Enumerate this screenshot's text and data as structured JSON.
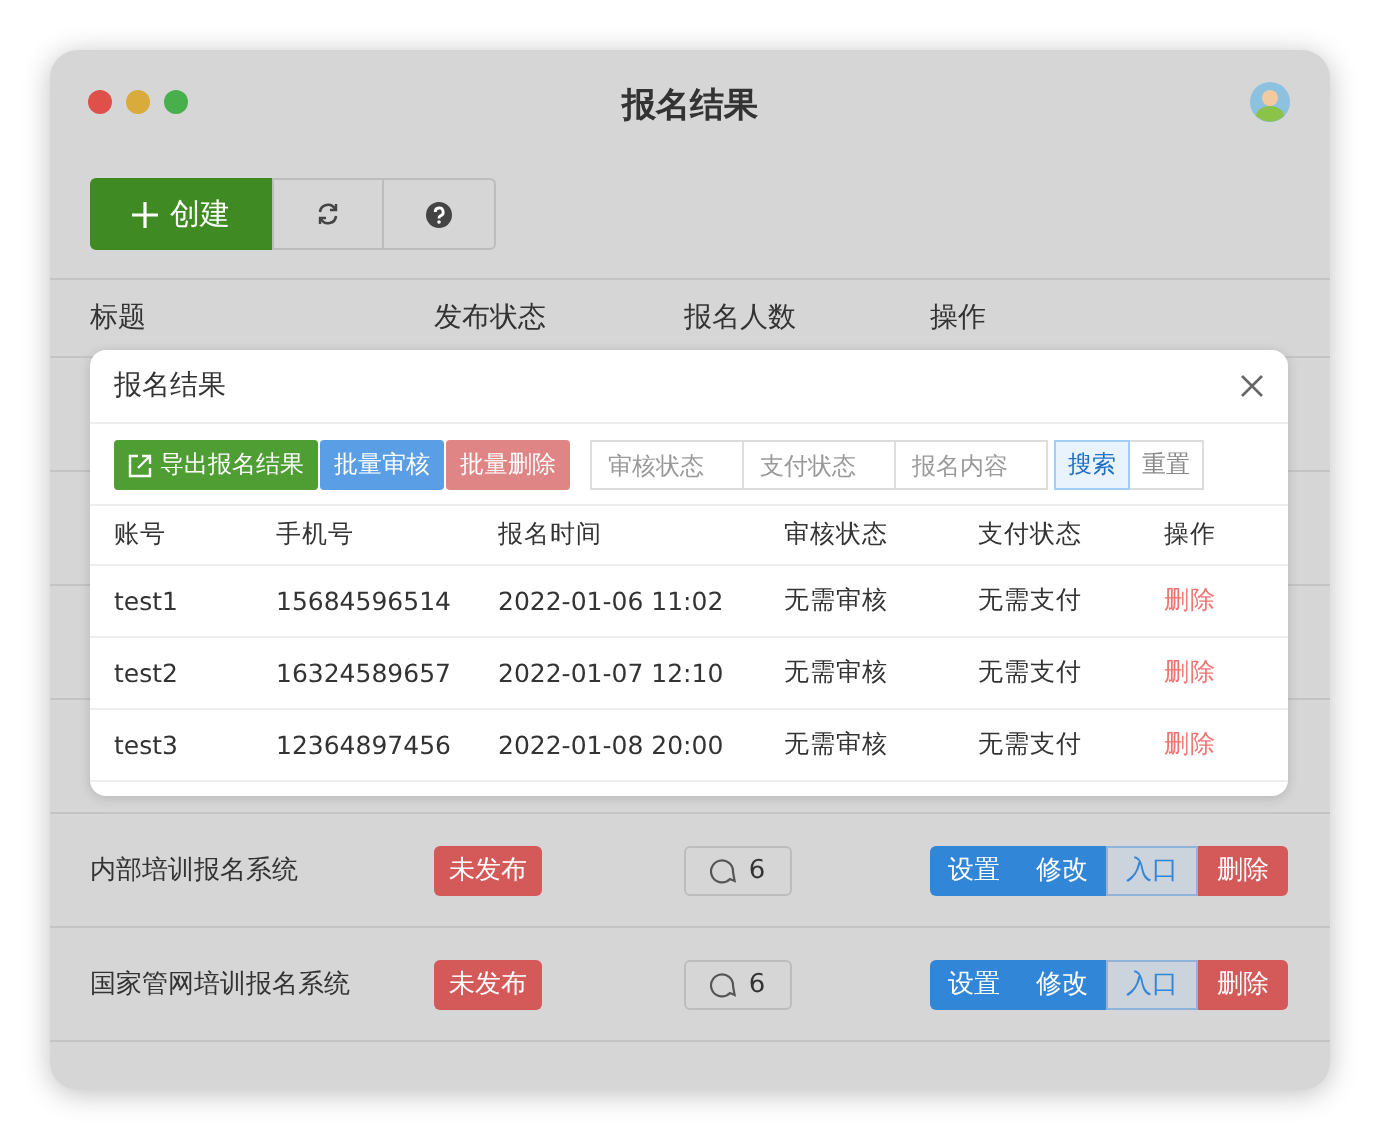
{
  "window": {
    "title": "报名结果"
  },
  "toolbar": {
    "create_button": "创建"
  },
  "table": {
    "columns": [
      "标题",
      "发布状态",
      "报名人数",
      "操作"
    ],
    "rows": [
      {
        "title": "内部培训报名系统",
        "status": "未发布",
        "count": "6",
        "actions": [
          {
            "label": "设置",
            "kind": "primary"
          },
          {
            "label": "修改",
            "kind": "primary"
          },
          {
            "label": "入口",
            "kind": "outline"
          },
          {
            "label": "删除",
            "kind": "danger"
          }
        ]
      },
      {
        "title": "国家管网培训报名系统",
        "status": "未发布",
        "count": "6",
        "actions": [
          {
            "label": "设置",
            "kind": "primary"
          },
          {
            "label": "修改",
            "kind": "primary"
          },
          {
            "label": "入口",
            "kind": "outline"
          },
          {
            "label": "删除",
            "kind": "danger"
          }
        ]
      }
    ]
  },
  "dialog": {
    "title": "报名结果",
    "buttons": [
      {
        "label": "导出报名结果",
        "kind": "export"
      },
      {
        "label": "批量审核",
        "kind": "info"
      },
      {
        "label": "批量删除",
        "kind": "danger"
      }
    ],
    "filters": [
      {
        "placeholder": "审核状态"
      },
      {
        "placeholder": "支付状态"
      },
      {
        "placeholder": "报名内容"
      }
    ],
    "search_button": "搜索",
    "reset_button": "重置",
    "columns": [
      "账号",
      "手机号",
      "报名时间",
      "审核状态",
      "支付状态",
      "操作"
    ],
    "rows": [
      {
        "account": "test1",
        "phone": "15684596514",
        "time": "2022-01-06 11:02",
        "review": "无需审核",
        "payment": "无需支付",
        "action": "删除"
      },
      {
        "account": "test2",
        "phone": "16324589657",
        "time": "2022-01-07 12:10",
        "review": "无需审核",
        "payment": "无需支付",
        "action": "删除"
      },
      {
        "account": "test3",
        "phone": "12364897456",
        "time": "2022-01-08 20:00",
        "review": "无需审核",
        "payment": "无需支付",
        "action": "删除"
      }
    ]
  }
}
